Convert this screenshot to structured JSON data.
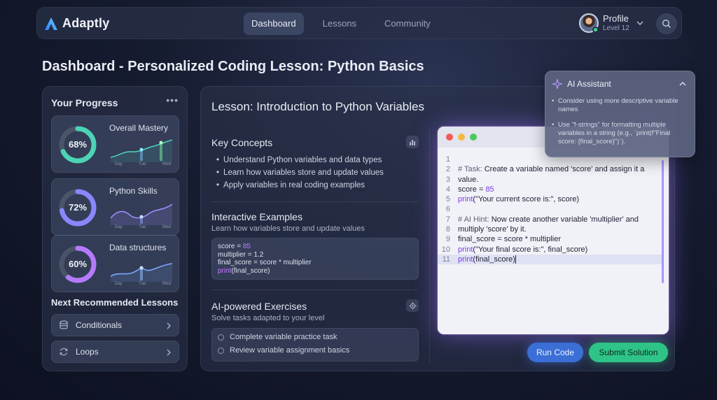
{
  "app": {
    "name": "Adaptly"
  },
  "nav": {
    "dashboard": "Dashboard",
    "lessons": "Lessons",
    "community": "Community"
  },
  "profile": {
    "name": "Profile",
    "level": "Level 12"
  },
  "page_title": "Dashboard - Personalized Coding Lesson: Python Basics",
  "progress": {
    "title": "Your Progress",
    "more": "•••",
    "cards": [
      {
        "label": "Overall Mastery",
        "percent": 68,
        "percent_label": "68%",
        "color": "#4cd3b5",
        "days": [
          "Day",
          "Tue",
          "Wed"
        ]
      },
      {
        "label": "Python Skills",
        "percent": 72,
        "percent_label": "72%",
        "color": "#8a86ff",
        "days": [
          "Day",
          "Tue",
          "Wed"
        ]
      },
      {
        "label": "Data structures",
        "percent": 60,
        "percent_label": "60%",
        "color": "#b57bff",
        "days": [
          "Day",
          "Tue",
          "Wed"
        ]
      }
    ]
  },
  "next_lessons": {
    "title": "Next Recommended Lessons",
    "items": [
      {
        "label": "Conditionals"
      },
      {
        "label": "Loops"
      }
    ]
  },
  "lesson": {
    "title": "Lesson: Introduction to Python Variables",
    "key_concepts": {
      "title": "Key Concepts",
      "items": [
        "Understand Python variables and data types",
        "Learn how variables store and update values",
        "Apply variables in real coding examples"
      ]
    },
    "interactive": {
      "title": "Interactive Examples",
      "subtitle": "Learn how variables store and update values",
      "code": [
        {
          "pre": "score = ",
          "hl": "85",
          "post": ""
        },
        {
          "pre": "multiplier = 1.2",
          "hl": "",
          "post": ""
        },
        {
          "pre": "final_score = score * multiplier",
          "hl": "",
          "post": ""
        },
        {
          "pre": "",
          "hl": "print",
          "post": "(final_score)"
        }
      ]
    },
    "exercises": {
      "title": "AI-powered Exercises",
      "subtitle": "Solve tasks adapted to your level",
      "items": [
        "Complete variable practice task",
        "Review variable assignment basics"
      ]
    }
  },
  "editor": {
    "lines": [
      {
        "n": "1",
        "parts": []
      },
      {
        "n": "2",
        "parts": [
          {
            "c": "cm",
            "t": "# Task: "
          },
          {
            "c": "",
            "t": "Create a variable named 'score' and assign it a"
          }
        ]
      },
      {
        "n": "3",
        "parts": [
          {
            "c": "",
            "t": "value."
          }
        ]
      },
      {
        "n": "4",
        "parts": [
          {
            "c": "",
            "t": "score = "
          },
          {
            "c": "nm",
            "t": "85"
          }
        ]
      },
      {
        "n": "5",
        "parts": [
          {
            "c": "fn",
            "t": "print"
          },
          {
            "c": "",
            "t": "(\"Your current score is:\", score)"
          }
        ]
      },
      {
        "n": "6",
        "parts": []
      },
      {
        "n": "7",
        "parts": [
          {
            "c": "cm",
            "t": "# AI Hint: "
          },
          {
            "c": "",
            "t": "Now create another variable 'multiplier' and"
          }
        ]
      },
      {
        "n": "8",
        "parts": [
          {
            "c": "",
            "t": "multiply 'score' by it."
          }
        ]
      },
      {
        "n": "9",
        "parts": [
          {
            "c": "",
            "t": "final_score = score * multiplier"
          }
        ]
      },
      {
        "n": "10",
        "parts": [
          {
            "c": "fn",
            "t": "print"
          },
          {
            "c": "",
            "t": "(\"Your final score is:\", final_score)"
          }
        ]
      },
      {
        "n": "11",
        "parts": [
          {
            "c": "fn",
            "t": "print"
          },
          {
            "c": "",
            "t": "(final_score)"
          }
        ],
        "current": true
      }
    ]
  },
  "buttons": {
    "run": "Run Code",
    "submit": "Submit Solution"
  },
  "ai_assistant": {
    "title": "AI Assistant",
    "tips": [
      "Consider using more descriptive variable names",
      "Use \"f-strings\" for formatting multiple variables in a string (e.g., `print(f\"Final score: {final_score}\")`)."
    ]
  },
  "colors": {
    "accent": "#7c3aed",
    "run": "#3b6fd6",
    "submit": "#2fc487",
    "status_online": "#3ddc84"
  },
  "icons": {
    "brand": "adaptly-logo-icon",
    "search": "search-icon",
    "more": "more-horizontal-icon",
    "chart": "bar-chart-icon",
    "settings": "gear-icon",
    "ai": "sparkle-icon",
    "database": "database-icon",
    "loop": "refresh-icon"
  }
}
